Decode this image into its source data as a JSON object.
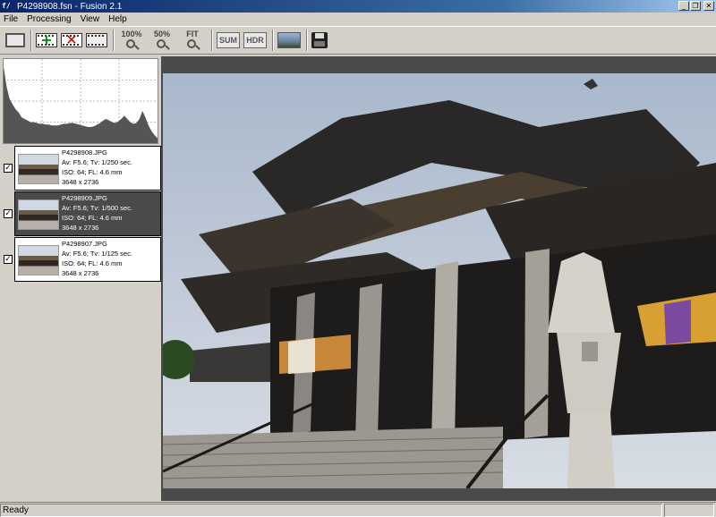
{
  "window": {
    "title": "P4298908.fsn - Fusion 2.1",
    "app_icon_text": "f/"
  },
  "title_buttons": {
    "minimize": "_",
    "restore": "❐",
    "close": "✕"
  },
  "menu": [
    {
      "label": "File"
    },
    {
      "label": "Processing"
    },
    {
      "label": "View"
    },
    {
      "label": "Help"
    }
  ],
  "toolbar": {
    "zoom100": "100%",
    "zoom50": "50%",
    "zoomfit": "FIT",
    "sum": "SUM",
    "hdr": "HDR"
  },
  "histogram": {
    "values": [
      0.95,
      0.7,
      0.55,
      0.48,
      0.42,
      0.38,
      0.32,
      0.3,
      0.28,
      0.26,
      0.26,
      0.25,
      0.24,
      0.24,
      0.23,
      0.23,
      0.22,
      0.22,
      0.22,
      0.23,
      0.24,
      0.24,
      0.25,
      0.25,
      0.24,
      0.23,
      0.22,
      0.21,
      0.2,
      0.2,
      0.21,
      0.23,
      0.25,
      0.28,
      0.3,
      0.28,
      0.26,
      0.25,
      0.27,
      0.3,
      0.34,
      0.3,
      0.26,
      0.24,
      0.25,
      0.3,
      0.4,
      0.32,
      0.22,
      0.15,
      0.1,
      0.06
    ]
  },
  "thumbnails": [
    {
      "file": "P4298908.JPG",
      "exposure": "Av: F5.6; Tv: 1/250 sec.",
      "iso": "ISO: 64; FL: 4.6 mm",
      "size": "3648 x 2736",
      "checked": true,
      "selected": false
    },
    {
      "file": "P4298909.JPG",
      "exposure": "Av: F5.6; Tv: 1/500 sec.",
      "iso": "ISO: 64; FL: 4.6 mm",
      "size": "3648 x 2736",
      "checked": true,
      "selected": true
    },
    {
      "file": "P4298907.JPG",
      "exposure": "Av: F5.6; Tv: 1/125 sec.",
      "iso": "ISO: 64; FL: 4.6 mm",
      "size": "3648 x 2736",
      "checked": true,
      "selected": false
    }
  ],
  "status": {
    "text": "Ready"
  }
}
